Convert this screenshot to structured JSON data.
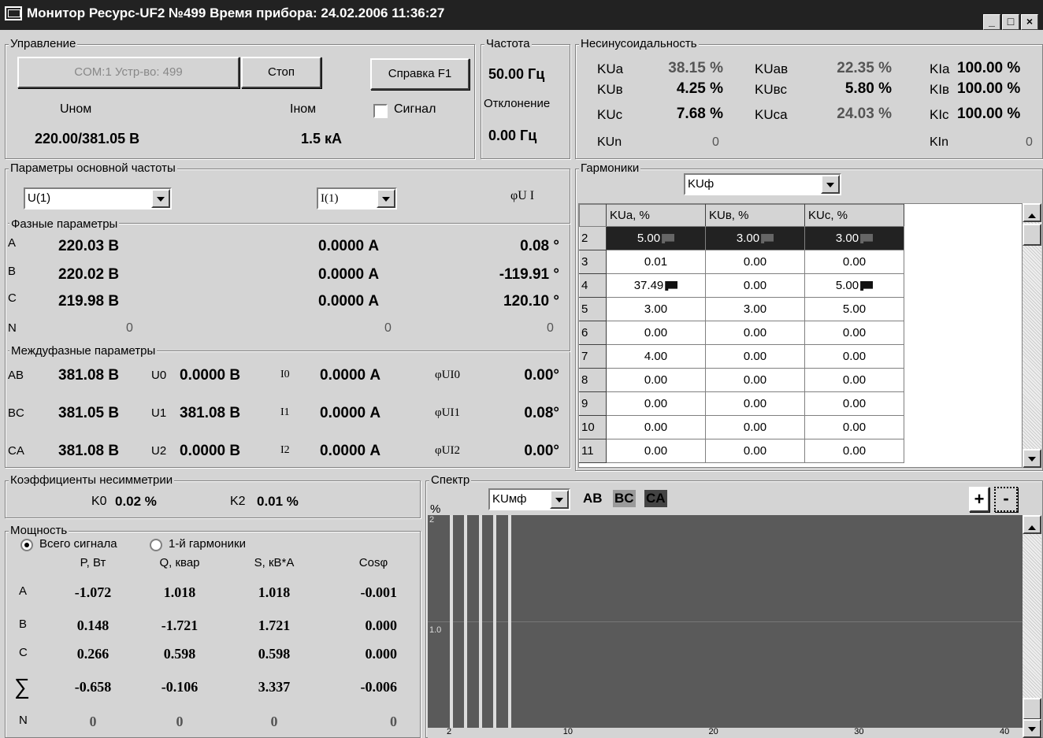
{
  "window": {
    "title": "Монитор Ресурс-UF2 №499  Время прибора: 24.02.2006 11:36:27",
    "min": "_",
    "max": "□",
    "close": "×"
  },
  "control": {
    "label": "Управление",
    "com_button": "COM:1 Устр-во: 499",
    "stop_button": "Стоп",
    "help_button": "Справка  F1",
    "unom_label": "Uном",
    "inom_label": "Iном",
    "signal_label": "Сигнал",
    "unom_value": "220.00/381.05 В",
    "inom_value": "1.5 кА"
  },
  "freq": {
    "label": "Частота",
    "value": "50.00 Гц",
    "dev_label": "Отклонение",
    "dev_value": "0.00 Гц"
  },
  "nonsin": {
    "label": "Несинусоидальность",
    "rows": [
      {
        "a": "KUa",
        "av": "38.15 %",
        "b": "KUав",
        "bv": "22.35 %",
        "c": "KIa",
        "cv": "100.00 %"
      },
      {
        "a": "KUв",
        "av": "4.25 %",
        "b": "KUвс",
        "bv": "5.80 %",
        "c": "KIв",
        "cv": "100.00 %"
      },
      {
        "a": "KUc",
        "av": "7.68 %",
        "b": "KUca",
        "bv": "24.03 %",
        "c": "KIc",
        "cv": "100.00 %"
      }
    ],
    "n_label": "KUn",
    "n_value": "0",
    "in_label": "KIn",
    "in_value": "0"
  },
  "basic": {
    "label": "Параметры основной частоты",
    "u_select": "U(1)",
    "i_select": "I(1)",
    "phi_label": "φU I",
    "phase_label": "Фазные параметры",
    "phases": [
      {
        "n": "A",
        "u": "220.03 В",
        "i": "0.0000 А",
        "phi": "0.08 °"
      },
      {
        "n": "B",
        "u": "220.02 В",
        "i": "0.0000 А",
        "phi": "-119.91 °"
      },
      {
        "n": "C",
        "u": "219.98 В",
        "i": "0.0000 А",
        "phi": "120.10 °"
      }
    ],
    "n_row": {
      "n": "N",
      "u": "0",
      "i": "0",
      "phi": "0"
    },
    "inter_label": "Междуфазные параметры",
    "inter": [
      {
        "n": "AB",
        "u": "381.08 В",
        "ul": "U0",
        "uv": "0.0000 В",
        "il": "I0",
        "iv": "0.0000 А",
        "pl": "φUI0",
        "pv": "0.00°"
      },
      {
        "n": "BC",
        "u": "381.05 В",
        "ul": "U1",
        "uv": "381.08 В",
        "il": "I1",
        "iv": "0.0000 А",
        "pl": "φUI1",
        "pv": "0.08°"
      },
      {
        "n": "CA",
        "u": "381.08 В",
        "ul": "U2",
        "uv": "0.0000 В",
        "il": "I2",
        "iv": "0.0000 А",
        "pl": "φUI2",
        "pv": "0.00°"
      }
    ]
  },
  "asym": {
    "label": "Коэффициенты несимметрии",
    "k0_label": "K0",
    "k0": "0.02 %",
    "k2_label": "K2",
    "k2": "0.01 %"
  },
  "power": {
    "label": "Мощность",
    "radio1": "Всего сигнала",
    "radio2": "1-й гармоники",
    "headers": [
      "P, Вт",
      "Q, квар",
      "S, кВ*А",
      "Cosφ"
    ],
    "rows": [
      {
        "n": "A",
        "v": [
          "-1.072",
          "1.018",
          "1.018",
          "-0.001"
        ]
      },
      {
        "n": "B",
        "v": [
          "0.148",
          "-1.721",
          "1.721",
          "0.000"
        ]
      },
      {
        "n": "C",
        "v": [
          "0.266",
          "0.598",
          "0.598",
          "0.000"
        ]
      },
      {
        "n": "∑",
        "v": [
          "-0.658",
          "-0.106",
          "3.337",
          "-0.006"
        ]
      },
      {
        "n": "N",
        "v": [
          "0",
          "0",
          "0",
          "0"
        ]
      }
    ]
  },
  "harm": {
    "label": "Гармоники",
    "select": "KUф",
    "headers": [
      "KUa, %",
      "KUв, %",
      "KUc, %"
    ],
    "rows": [
      {
        "n": "2",
        "v": [
          "5.00",
          "3.00",
          "3.00"
        ],
        "f": [
          1,
          1,
          1
        ]
      },
      {
        "n": "3",
        "v": [
          "0.01",
          "0.00",
          "0.00"
        ],
        "f": [
          0,
          0,
          0
        ]
      },
      {
        "n": "4",
        "v": [
          "37.49",
          "0.00",
          "5.00"
        ],
        "f": [
          1,
          0,
          1
        ]
      },
      {
        "n": "5",
        "v": [
          "3.00",
          "3.00",
          "5.00"
        ],
        "f": [
          0,
          0,
          0
        ]
      },
      {
        "n": "6",
        "v": [
          "0.00",
          "0.00",
          "0.00"
        ],
        "f": [
          0,
          0,
          0
        ]
      },
      {
        "n": "7",
        "v": [
          "4.00",
          "0.00",
          "0.00"
        ],
        "f": [
          0,
          0,
          0
        ]
      },
      {
        "n": "8",
        "v": [
          "0.00",
          "0.00",
          "0.00"
        ],
        "f": [
          0,
          0,
          0
        ]
      },
      {
        "n": "9",
        "v": [
          "0.00",
          "0.00",
          "0.00"
        ],
        "f": [
          0,
          0,
          0
        ]
      },
      {
        "n": "10",
        "v": [
          "0.00",
          "0.00",
          "0.00"
        ],
        "f": [
          0,
          0,
          0
        ]
      },
      {
        "n": "11",
        "v": [
          "0.00",
          "0.00",
          "0.00"
        ],
        "f": [
          0,
          0,
          0
        ]
      }
    ]
  },
  "spectrum": {
    "label": "Спектр",
    "select": "KUмф",
    "unit": "%",
    "tags": [
      "AB",
      "BC",
      "CA"
    ],
    "plus": "+",
    "minus": "-",
    "y_top": "2",
    "y_mid": "1.0",
    "x_ticks": [
      "2",
      "10",
      "20",
      "30",
      "40"
    ]
  },
  "chart_data": {
    "type": "bar",
    "x": [
      2,
      3,
      4,
      5,
      6
    ],
    "ylim": [
      0,
      2
    ],
    "xlim": [
      2,
      40
    ]
  }
}
